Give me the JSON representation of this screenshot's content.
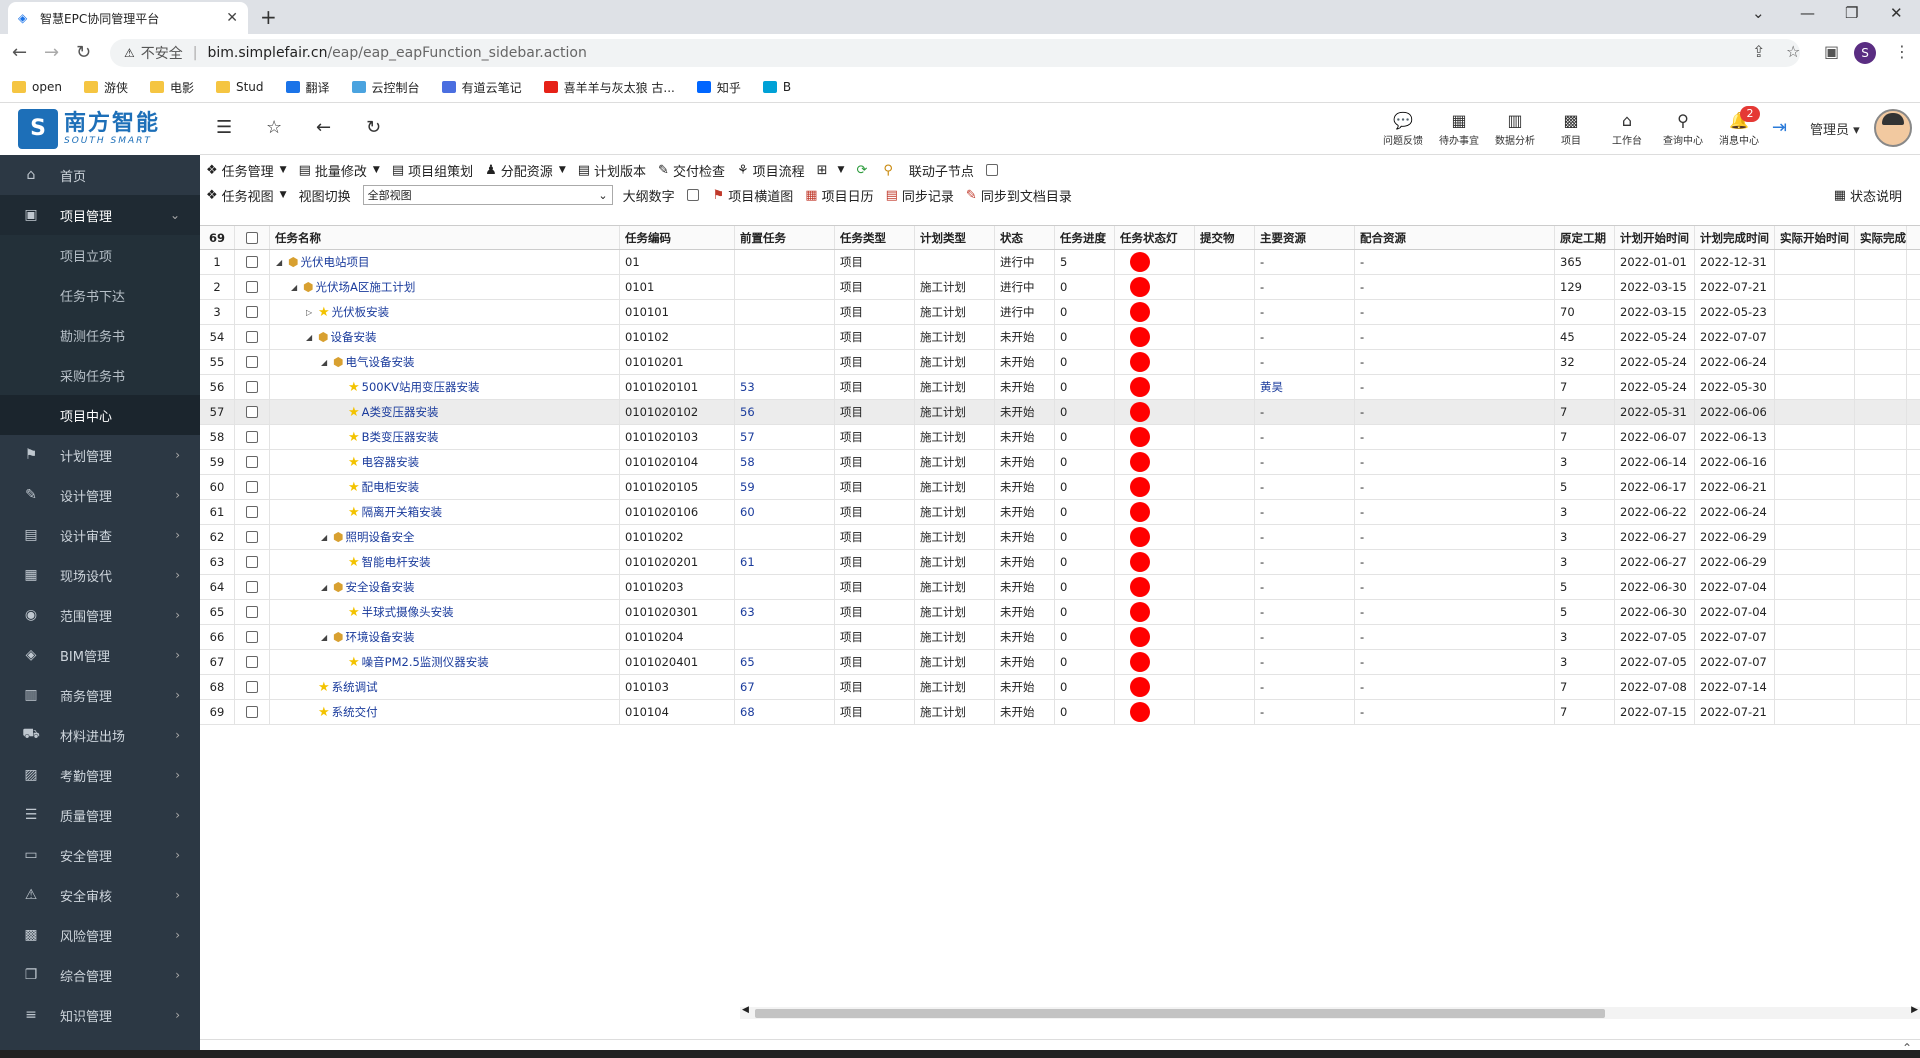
{
  "browser": {
    "tab_title": "智慧EPC协同管理平台",
    "close": "✕",
    "new_tab": "+",
    "insecure_label": "不安全",
    "url_host": "bim.simplefair.cn",
    "url_path": "/eap/eap_eapFunction_sidebar.action",
    "profile_initial": "S",
    "bookmarks": [
      {
        "label": "open",
        "color": "#f5c542"
      },
      {
        "label": "游侠",
        "color": "#f5c542"
      },
      {
        "label": "电影",
        "color": "#f5c542"
      },
      {
        "label": "Stud",
        "color": "#f5c542"
      },
      {
        "label": "翻译",
        "color": "#1a73e8"
      },
      {
        "label": "云控制台",
        "color": "#4aa3df"
      },
      {
        "label": "有道云笔记",
        "color": "#4a6ee0"
      },
      {
        "label": "喜羊羊与灰太狼 古...",
        "color": "#e62117"
      },
      {
        "label": "知乎",
        "color": "#0066ff"
      },
      {
        "label": "B",
        "color": "#00a1d6"
      }
    ]
  },
  "logo": {
    "mark": "S",
    "cn": "南方智能",
    "en": "SOUTH SMART"
  },
  "sidebar": {
    "items": [
      {
        "label": "首页",
        "icon": "home-icon",
        "glyph": "⌂"
      },
      {
        "label": "项目管理",
        "icon": "project-icon",
        "glyph": "▣",
        "active": true
      },
      {
        "label": "计划管理",
        "icon": "flag-icon",
        "glyph": "⚑"
      },
      {
        "label": "设计管理",
        "icon": "pencil-icon",
        "glyph": "✎"
      },
      {
        "label": "设计审查",
        "icon": "briefcase-icon",
        "glyph": "▤"
      },
      {
        "label": "现场设代",
        "icon": "id-card-icon",
        "glyph": "▦"
      },
      {
        "label": "范围管理",
        "icon": "ball-icon",
        "glyph": "◉"
      },
      {
        "label": "BIM管理",
        "icon": "cube-icon",
        "glyph": "◈"
      },
      {
        "label": "商务管理",
        "icon": "building-icon",
        "glyph": "▥"
      },
      {
        "label": "材料进出场",
        "icon": "truck-icon",
        "glyph": "⛟"
      },
      {
        "label": "考勤管理",
        "icon": "calendar-icon",
        "glyph": "▨"
      },
      {
        "label": "质量管理",
        "icon": "list-icon",
        "glyph": "☰"
      },
      {
        "label": "安全管理",
        "icon": "hdd-icon",
        "glyph": "▭"
      },
      {
        "label": "安全审核",
        "icon": "warning-icon",
        "glyph": "⚠"
      },
      {
        "label": "风险管理",
        "icon": "image-icon",
        "glyph": "▩"
      },
      {
        "label": "综合管理",
        "icon": "copy-icon",
        "glyph": "❐"
      },
      {
        "label": "知识管理",
        "icon": "list-ol-icon",
        "glyph": "≡"
      }
    ],
    "sub_items": [
      "项目立项",
      "任务书下达",
      "勘测任务书",
      "采购任务书",
      "项目中心"
    ]
  },
  "topbar": {
    "icons": [
      {
        "label": "问题反馈",
        "name": "feedback-icon",
        "glyph": "💬"
      },
      {
        "label": "待办事宜",
        "name": "todo-icon",
        "glyph": "▦"
      },
      {
        "label": "数据分析",
        "name": "chart-icon",
        "glyph": "▥"
      },
      {
        "label": "项目",
        "name": "grid-icon",
        "glyph": "▩"
      },
      {
        "label": "工作台",
        "name": "home-icon",
        "glyph": "⌂"
      },
      {
        "label": "查询中心",
        "name": "search-icon",
        "glyph": "⚲"
      },
      {
        "label": "消息中心",
        "name": "bell-icon",
        "glyph": "🔔"
      }
    ],
    "badge": "2",
    "user": "管理员"
  },
  "toolbar1": [
    {
      "label": "任务管理",
      "icon": "task-icon",
      "glyph": "❖",
      "dd": true
    },
    {
      "label": "批量修改",
      "icon": "batch-icon",
      "glyph": "▤",
      "dd": true
    },
    {
      "label": "项目组策划",
      "icon": "plan-icon",
      "glyph": "▤",
      "dd": false
    },
    {
      "label": "分配资源",
      "icon": "resource-icon",
      "glyph": "♟",
      "dd": true
    },
    {
      "label": "计划版本",
      "icon": "version-icon",
      "glyph": "▤",
      "dd": false
    },
    {
      "label": "交付检查",
      "icon": "check-icon",
      "glyph": "✎",
      "dd": false
    },
    {
      "label": "项目流程",
      "icon": "flow-icon",
      "glyph": "⚘",
      "dd": false
    }
  ],
  "toolbar1_tail": {
    "link_label": "联动子节点"
  },
  "toolbar2": {
    "task_view": "任务视图",
    "view_switch": "视图切换",
    "select_value": "全部视图",
    "outline_number": "大纲数字",
    "items": [
      {
        "label": "项目横道图",
        "icon": "gantt-icon",
        "glyph": "⚑"
      },
      {
        "label": "项目日历",
        "icon": "calendar-icon",
        "glyph": "▦"
      },
      {
        "label": "同步记录",
        "icon": "sync-icon",
        "glyph": "▤"
      },
      {
        "label": "同步到文档目录",
        "icon": "doc-sync-icon",
        "glyph": "✎"
      }
    ],
    "status_help": "状态说明"
  },
  "table": {
    "header_count": "69",
    "columns": [
      "任务名称",
      "任务编码",
      "前置任务",
      "任务类型",
      "计划类型",
      "状态",
      "任务进度",
      "任务状态灯",
      "提交物",
      "主要资源",
      "配合资源",
      "原定工期",
      "计划开始时间",
      "计划完成时间",
      "实际开始时间",
      "实际完成时间"
    ],
    "rows": [
      {
        "n": "1",
        "level": 0,
        "tri": "◢",
        "icon": "box",
        "name": "光伏电站项目",
        "code": "01",
        "pre": "",
        "type": "项目",
        "plan": "",
        "status": "进行中",
        "prog": "5",
        "main": "-",
        "coop": "-",
        "dur": "365",
        "start": "2022-01-01",
        "end": "2022-12-31"
      },
      {
        "n": "2",
        "level": 1,
        "tri": "◢",
        "icon": "box",
        "name": "光伏场A区施工计划",
        "code": "0101",
        "pre": "",
        "type": "项目",
        "plan": "施工计划",
        "status": "进行中",
        "prog": "0",
        "main": "-",
        "coop": "-",
        "dur": "129",
        "start": "2022-03-15",
        "end": "2022-07-21"
      },
      {
        "n": "3",
        "level": 2,
        "tri": "▷",
        "icon": "star",
        "name": "光伏板安装",
        "code": "010101",
        "pre": "",
        "type": "项目",
        "plan": "施工计划",
        "status": "进行中",
        "prog": "0",
        "main": "-",
        "coop": "-",
        "dur": "70",
        "start": "2022-03-15",
        "end": "2022-05-23"
      },
      {
        "n": "54",
        "level": 2,
        "tri": "◢",
        "icon": "box",
        "name": "设备安装",
        "code": "010102",
        "pre": "",
        "type": "项目",
        "plan": "施工计划",
        "status": "未开始",
        "prog": "0",
        "main": "-",
        "coop": "-",
        "dur": "45",
        "start": "2022-05-24",
        "end": "2022-07-07"
      },
      {
        "n": "55",
        "level": 3,
        "tri": "◢",
        "icon": "box",
        "name": "电气设备安装",
        "code": "01010201",
        "pre": "",
        "type": "项目",
        "plan": "施工计划",
        "status": "未开始",
        "prog": "0",
        "main": "-",
        "coop": "-",
        "dur": "32",
        "start": "2022-05-24",
        "end": "2022-06-24"
      },
      {
        "n": "56",
        "level": 4,
        "tri": "",
        "icon": "star",
        "name": "500KV站用变压器安装",
        "code": "0101020101",
        "pre": "53",
        "type": "项目",
        "plan": "施工计划",
        "status": "未开始",
        "prog": "0",
        "main": "黄昊",
        "coop": "-",
        "dur": "7",
        "start": "2022-05-24",
        "end": "2022-05-30"
      },
      {
        "n": "57",
        "level": 4,
        "tri": "",
        "icon": "star",
        "name": "A类变压器安装",
        "code": "0101020102",
        "pre": "56",
        "type": "项目",
        "plan": "施工计划",
        "status": "未开始",
        "prog": "0",
        "main": "-",
        "coop": "-",
        "dur": "7",
        "start": "2022-05-31",
        "end": "2022-06-06",
        "hl": true
      },
      {
        "n": "58",
        "level": 4,
        "tri": "",
        "icon": "star",
        "name": "B类变压器安装",
        "code": "0101020103",
        "pre": "57",
        "type": "项目",
        "plan": "施工计划",
        "status": "未开始",
        "prog": "0",
        "main": "-",
        "coop": "-",
        "dur": "7",
        "start": "2022-06-07",
        "end": "2022-06-13"
      },
      {
        "n": "59",
        "level": 4,
        "tri": "",
        "icon": "star",
        "name": "电容器安装",
        "code": "0101020104",
        "pre": "58",
        "type": "项目",
        "plan": "施工计划",
        "status": "未开始",
        "prog": "0",
        "main": "-",
        "coop": "-",
        "dur": "3",
        "start": "2022-06-14",
        "end": "2022-06-16"
      },
      {
        "n": "60",
        "level": 4,
        "tri": "",
        "icon": "star",
        "name": "配电柜安装",
        "code": "0101020105",
        "pre": "59",
        "type": "项目",
        "plan": "施工计划",
        "status": "未开始",
        "prog": "0",
        "main": "-",
        "coop": "-",
        "dur": "5",
        "start": "2022-06-17",
        "end": "2022-06-21"
      },
      {
        "n": "61",
        "level": 4,
        "tri": "",
        "icon": "star",
        "name": "隔离开关箱安装",
        "code": "0101020106",
        "pre": "60",
        "type": "项目",
        "plan": "施工计划",
        "status": "未开始",
        "prog": "0",
        "main": "-",
        "coop": "-",
        "dur": "3",
        "start": "2022-06-22",
        "end": "2022-06-24"
      },
      {
        "n": "62",
        "level": 3,
        "tri": "◢",
        "icon": "box",
        "name": "照明设备安全",
        "code": "01010202",
        "pre": "",
        "type": "项目",
        "plan": "施工计划",
        "status": "未开始",
        "prog": "0",
        "main": "-",
        "coop": "-",
        "dur": "3",
        "start": "2022-06-27",
        "end": "2022-06-29"
      },
      {
        "n": "63",
        "level": 4,
        "tri": "",
        "icon": "star",
        "name": "智能电杆安装",
        "code": "0101020201",
        "pre": "61",
        "type": "项目",
        "plan": "施工计划",
        "status": "未开始",
        "prog": "0",
        "main": "-",
        "coop": "-",
        "dur": "3",
        "start": "2022-06-27",
        "end": "2022-06-29"
      },
      {
        "n": "64",
        "level": 3,
        "tri": "◢",
        "icon": "box",
        "name": "安全设备安装",
        "code": "01010203",
        "pre": "",
        "type": "项目",
        "plan": "施工计划",
        "status": "未开始",
        "prog": "0",
        "main": "-",
        "coop": "-",
        "dur": "5",
        "start": "2022-06-30",
        "end": "2022-07-04"
      },
      {
        "n": "65",
        "level": 4,
        "tri": "",
        "icon": "star",
        "name": "半球式摄像头安装",
        "code": "0101020301",
        "pre": "63",
        "type": "项目",
        "plan": "施工计划",
        "status": "未开始",
        "prog": "0",
        "main": "-",
        "coop": "-",
        "dur": "5",
        "start": "2022-06-30",
        "end": "2022-07-04"
      },
      {
        "n": "66",
        "level": 3,
        "tri": "◢",
        "icon": "box",
        "name": "环境设备安装",
        "code": "01010204",
        "pre": "",
        "type": "项目",
        "plan": "施工计划",
        "status": "未开始",
        "prog": "0",
        "main": "-",
        "coop": "-",
        "dur": "3",
        "start": "2022-07-05",
        "end": "2022-07-07"
      },
      {
        "n": "67",
        "level": 4,
        "tri": "",
        "icon": "star",
        "name": "噪音PM2.5监测仪器安装",
        "code": "0101020401",
        "pre": "65",
        "type": "项目",
        "plan": "施工计划",
        "status": "未开始",
        "prog": "0",
        "main": "-",
        "coop": "-",
        "dur": "3",
        "start": "2022-07-05",
        "end": "2022-07-07"
      },
      {
        "n": "68",
        "level": 2,
        "tri": "",
        "icon": "star",
        "name": "系统调试",
        "code": "010103",
        "pre": "67",
        "type": "项目",
        "plan": "施工计划",
        "status": "未开始",
        "prog": "0",
        "main": "-",
        "coop": "-",
        "dur": "7",
        "start": "2022-07-08",
        "end": "2022-07-14"
      },
      {
        "n": "69",
        "level": 2,
        "tri": "",
        "icon": "star",
        "name": "系统交付",
        "code": "010104",
        "pre": "68",
        "type": "项目",
        "plan": "施工计划",
        "status": "未开始",
        "prog": "0",
        "main": "-",
        "coop": "-",
        "dur": "7",
        "start": "2022-07-15",
        "end": "2022-07-21"
      }
    ]
  },
  "colors": {
    "sidebar_bg": "#2c3844",
    "status_light": "#ff0000",
    "link": "#1a3b9c",
    "badge": "#e53935"
  }
}
